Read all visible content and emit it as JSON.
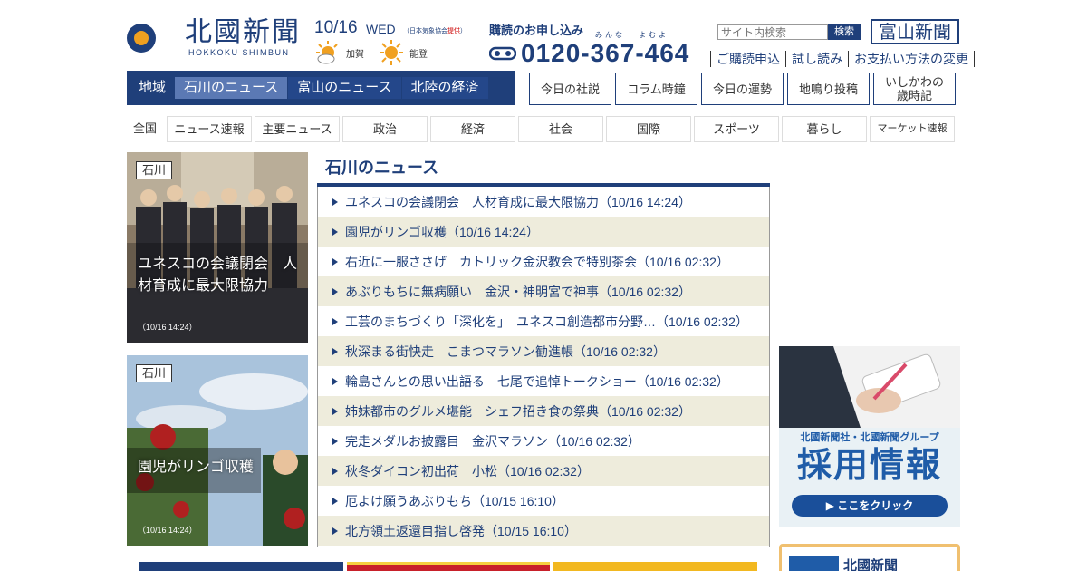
{
  "header": {
    "logo_jp": "北國新聞",
    "logo_en": "HOKKOKU SHIMBUN",
    "date": "10/16",
    "weekday": "WED",
    "weather_source_prefix": "（日本気象協会",
    "weather_source_link": "提供",
    "weather_source_suffix": "）",
    "weather": [
      {
        "area": "加賀",
        "icon": "sun-cloud-icon"
      },
      {
        "area": "能登",
        "icon": "sun-icon"
      }
    ],
    "subscribe_title": "購読のお申し込み",
    "ruby_1": "みんな",
    "ruby_2": "よむよ",
    "phone": "0120-367-464",
    "search_placeholder": "サイト内検索",
    "search_button": "検索",
    "toyama_logo": "富山新聞",
    "links": [
      "ご購読申込",
      "試し読み",
      "お支払い方法の変更"
    ]
  },
  "region_tabs": [
    {
      "label": "地域",
      "state": "label"
    },
    {
      "label": "石川のニュース",
      "state": "active"
    },
    {
      "label": "富山のニュース",
      "state": "other"
    },
    {
      "label": "北陸の経済",
      "state": "other"
    }
  ],
  "section_buttons": [
    "今日の社説",
    "コラム時鐘",
    "今日の運勢",
    "地鳴り投稿",
    "いしかわの歳時記"
  ],
  "categories": [
    "全国",
    "ニュース速報",
    "主要ニュース",
    "政治",
    "経済",
    "社会",
    "国際",
    "スポーツ",
    "暮らし",
    "マーケット速報"
  ],
  "featured": [
    {
      "tag": "石川",
      "caption": "ユネスコの会議閉会　人材育成に最大限協力",
      "time": "（10/16 14:24）"
    },
    {
      "tag": "石川",
      "caption": "園児がリンゴ収穫",
      "time": "（10/16 14:24）"
    }
  ],
  "news": {
    "title": "石川のニュース",
    "items": [
      "ユネスコの会議閉会　人材育成に最大限協力（10/16 14:24）",
      "園児がリンゴ収穫（10/16 14:24）",
      "右近に一服ささげ　カトリック金沢教会で特別茶会（10/16 02:32）",
      "あぶりもちに無病願い　金沢・神明宮で神事（10/16 02:32）",
      "工芸のまちづくり「深化を」　ユネスコ創造都市分野…（10/16 02:32）",
      "秋深まる街快走　こまつマラソン勧進帳（10/16 02:32）",
      "輪島さんとの思い出語る　七尾で追悼トークショー（10/16 02:32）",
      "姉妹都市のグルメ堪能　シェフ招き食の祭典（10/16 02:32）",
      "完走メダルお披露目　金沢マラソン（10/16 02:32）",
      "秋冬ダイコン初出荷　小松（10/16 02:32）",
      "厄よけ願うあぶりもち（10/15 16:10）",
      "北方領土返還目指し啓発（10/15 16:10）"
    ]
  },
  "ad": {
    "line1": "北國新聞社・北國新聞グループ",
    "line2": "採用情報",
    "button": "▶ ここをクリック"
  },
  "side_box": {
    "title": "北國新聞"
  }
}
